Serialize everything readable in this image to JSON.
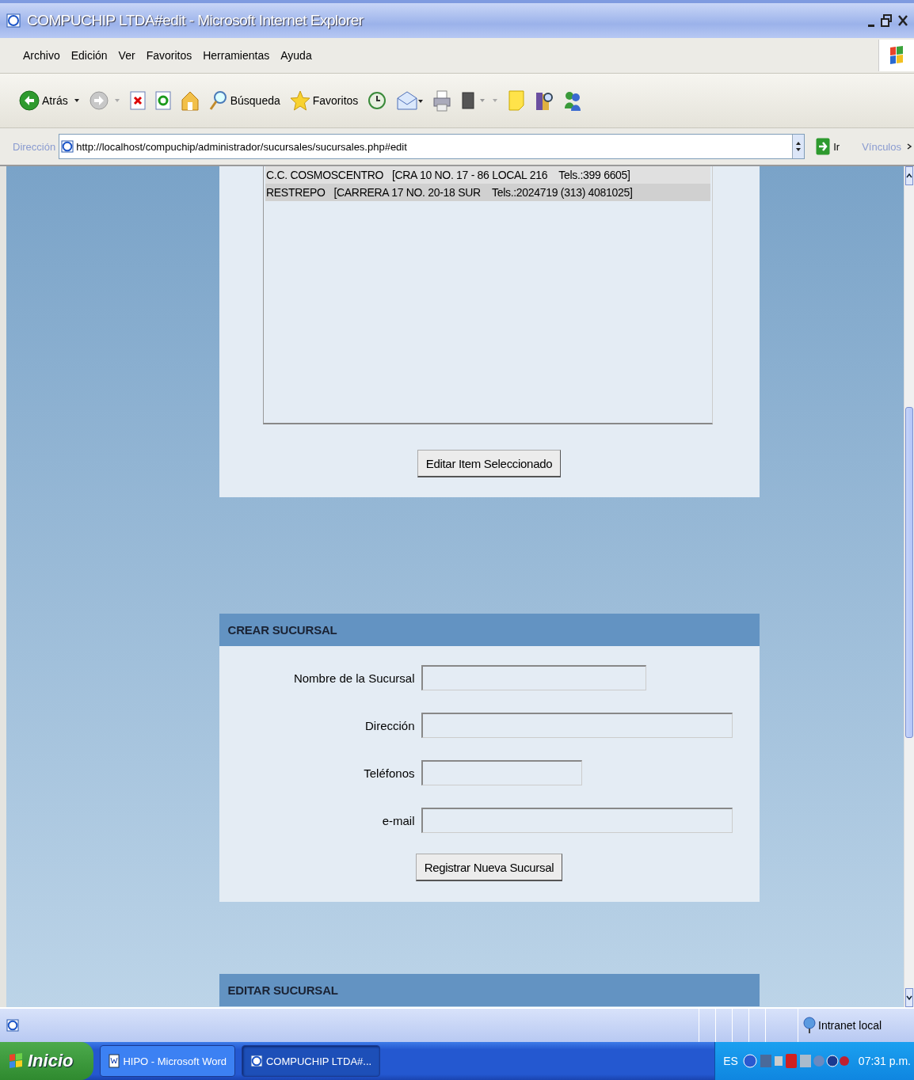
{
  "window": {
    "title": "COMPUCHIP LTDA#edit - Microsoft Internet Explorer"
  },
  "menu": [
    "Archivo",
    "Edición",
    "Ver",
    "Favoritos",
    "Herramientas",
    "Ayuda"
  ],
  "toolbar": [
    {
      "kind": "back",
      "label": "Atrás"
    },
    {
      "kind": "forward"
    },
    {
      "kind": "stop"
    },
    {
      "kind": "refresh"
    },
    {
      "kind": "home"
    },
    {
      "kind": "search",
      "label": "Búsqueda"
    },
    {
      "kind": "favorites",
      "label": "Favoritos"
    },
    {
      "kind": "history"
    },
    {
      "kind": "mail"
    },
    {
      "kind": "print"
    },
    {
      "kind": "edit"
    },
    {
      "kind": "note"
    },
    {
      "kind": "research"
    },
    {
      "kind": "messenger"
    }
  ],
  "address": {
    "label": "Dirección",
    "value": "http://localhost/compuchip/administrador/sucursales/sucursales.php#edit",
    "go": "Ir",
    "links": "Vínculos"
  },
  "branch_list": {
    "items": [
      {
        "text": "C.C. COSMOSCENTRO   [CRA 10 NO. 17 - 86 LOCAL 216    Tels.:399 6605]",
        "selected": false
      },
      {
        "text": "RESTREPO   [CARRERA 17 NO. 20-18 SUR    Tels.:2024719 (313) 4081025]",
        "selected": true
      }
    ],
    "button": "Editar Item Seleccionado"
  },
  "create_form": {
    "title": "CREAR SUCURSAL",
    "fields": [
      {
        "label": "Nombre de la Sucursal"
      },
      {
        "label": "Dirección"
      },
      {
        "label": "Teléfonos"
      },
      {
        "label": "e-mail"
      }
    ],
    "button": "Registrar Nueva Sucursal"
  },
  "edit_section": {
    "title": "EDITAR SUCURSAL"
  },
  "status_bar": {
    "zone": "Intranet local"
  },
  "taskbar": {
    "start": "Inicio",
    "tasks": [
      {
        "label": "HIPO - Microsoft Word",
        "selected": false
      },
      {
        "label": "COMPUCHIP LTDA#...",
        "selected": true
      }
    ],
    "language": "ES",
    "clock": "07:31 p.m."
  }
}
